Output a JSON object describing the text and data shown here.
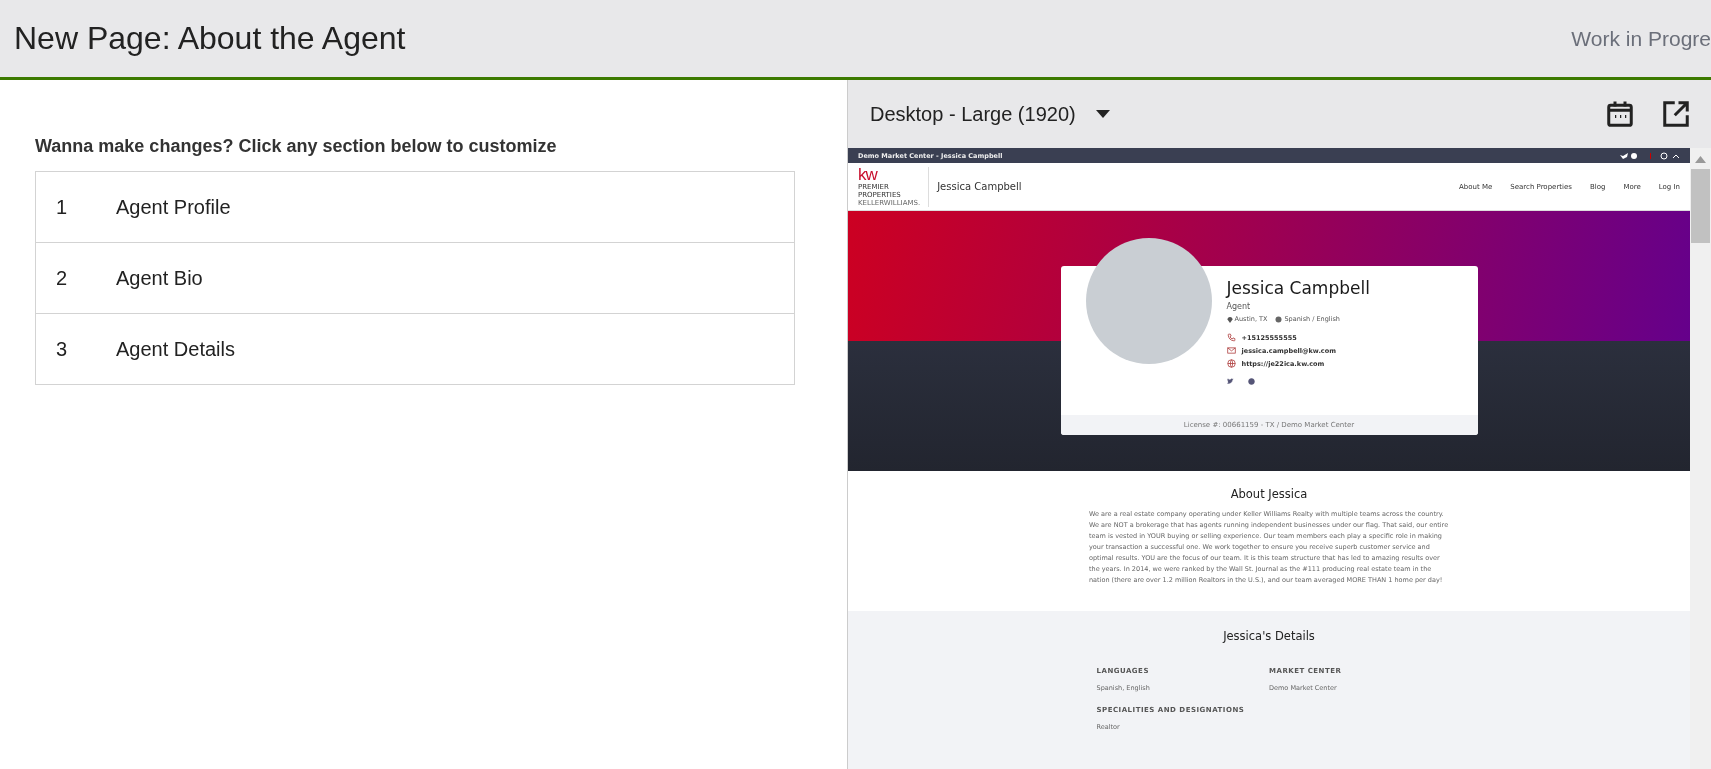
{
  "header": {
    "title": "New Page: About the Agent",
    "status": "Work in Progre"
  },
  "instructions": "Wanna make changes? Click any section below to customize",
  "sections": [
    {
      "number": "1",
      "label": "Agent Profile"
    },
    {
      "number": "2",
      "label": "Agent Bio"
    },
    {
      "number": "3",
      "label": "Agent Details"
    }
  ],
  "preview": {
    "device": "Desktop - Large (1920)",
    "site": {
      "topbar": "Demo Market Center - Jessica Campbell",
      "brand": {
        "logo_mark": "kw",
        "logo_lines": [
          "PREMIER",
          "PROPERTIES"
        ],
        "logo_sub": "KELLERWILLIAMS.",
        "name": "Jessica Campbell"
      },
      "nav": [
        "About Me",
        "Search Properties",
        "Blog",
        "More",
        "Log In"
      ],
      "agent": {
        "name": "Jessica Campbell",
        "role": "Agent",
        "location": "Austin, TX",
        "languages": "Spanish / English",
        "phone": "+15125555555",
        "email": "jessica.campbell@kw.com",
        "website": "https://je22ica.kw.com",
        "license": "License #: 00661159 - TX / Demo Market Center"
      },
      "about": {
        "title": "About Jessica",
        "text": "We are a real estate company operating under Keller Williams Realty with multiple teams across the country. We are NOT a brokerage that has agents running independent businesses under our flag. That said, our entire team is vested in YOUR buying or selling experience. Our team members each play a specific role in making your transaction a successful one. We work together to ensure you receive superb customer service and optimal results. YOU are the focus of our team. It is this team structure that has led to amazing results over the years. In 2014, we were ranked by the Wall St. Journal as the #111 producing real estate team in the nation (there are over 1.2 million Realtors in the U.S.), and our team averaged MORE THAN 1 home per day!"
      },
      "details": {
        "title": "Jessica's Details",
        "fields": [
          {
            "label": "LANGUAGES",
            "value": "Spanish, English"
          },
          {
            "label": "MARKET CENTER",
            "value": "Demo Market Center"
          },
          {
            "label": "SPECIALITIES AND DESIGNATIONS",
            "value": "Realtor"
          }
        ]
      }
    }
  }
}
